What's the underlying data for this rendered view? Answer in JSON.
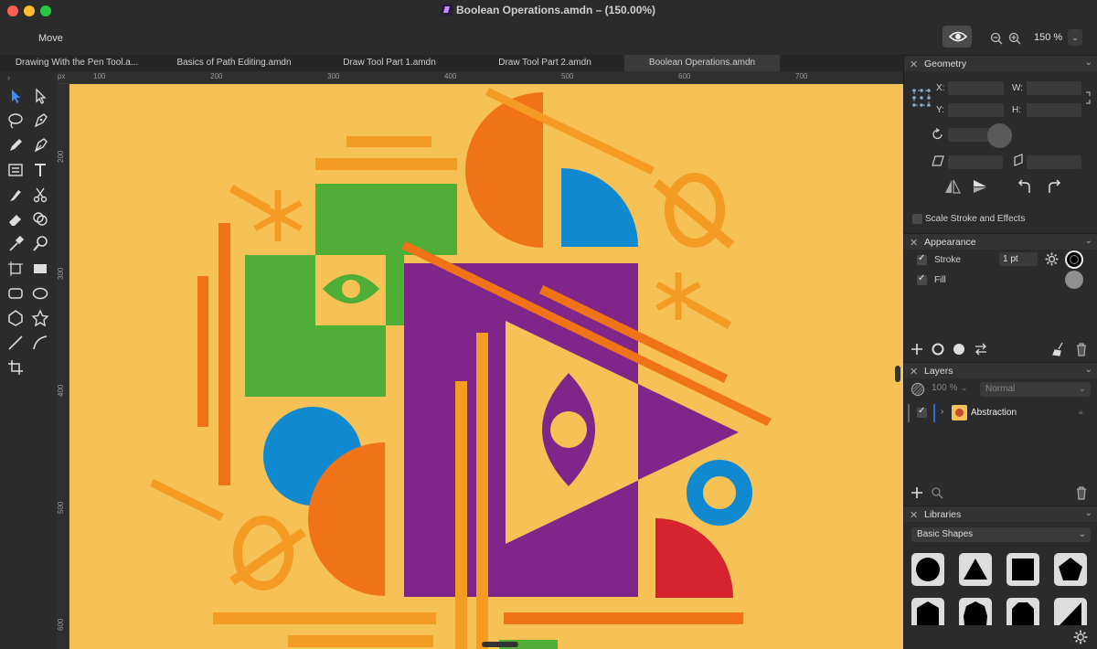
{
  "window": {
    "title": "Boolean Operations.amdn – (150.00%)"
  },
  "toolbar": {
    "current_tool": "Move",
    "zoom_value": "150 %"
  },
  "tabs": [
    {
      "label": "Drawing With the Pen Tool.a..."
    },
    {
      "label": "Basics of Path Editing.amdn"
    },
    {
      "label": "Draw Tool Part 1.amdn"
    },
    {
      "label": "Draw Tool Part 2.amdn"
    },
    {
      "label": "Boolean Operations.amdn",
      "active": true
    }
  ],
  "ruler": {
    "unit": "px",
    "top_ticks": [
      "100",
      "200",
      "300",
      "400",
      "500",
      "600",
      "700"
    ],
    "left_ticks": [
      "200",
      "300",
      "400",
      "500",
      "600"
    ]
  },
  "geometry": {
    "title": "Geometry",
    "x_label": "X:",
    "y_label": "Y:",
    "w_label": "W:",
    "h_label": "H:",
    "scale_stroke_label": "Scale Stroke and Effects"
  },
  "appearance": {
    "title": "Appearance",
    "stroke_label": "Stroke",
    "stroke_value": "1 pt",
    "fill_label": "Fill"
  },
  "layers": {
    "title": "Layers",
    "opacity": "100 %",
    "blend_mode": "Normal",
    "items": [
      {
        "label": "Abstraction"
      }
    ]
  },
  "libraries": {
    "title": "Libraries",
    "selected": "Basic Shapes"
  },
  "colors": {
    "canvas": "#f6c255",
    "orange": "#f07318",
    "light_orange": "#f49b23",
    "green": "#4fae35",
    "purple": "#80268a",
    "blue": "#1189d1",
    "red": "#d6232d"
  },
  "icons": {
    "tools": [
      "move-tool",
      "node-tool",
      "lasso-tool",
      "pen-tool",
      "pencil-tool",
      "brush-tool",
      "text-frame-tool",
      "text-tool",
      "knife-tool",
      "scissors-tool",
      "eraser-tool",
      "shape-builder-tool",
      "eyedropper-tool",
      "zoom-tool",
      "artboard-tool",
      "rectangle-tool",
      "rounded-rect-tool",
      "ellipse-tool",
      "polygon-tool",
      "star-tool",
      "line-tool",
      "arc-tool",
      "crop-tool"
    ]
  }
}
